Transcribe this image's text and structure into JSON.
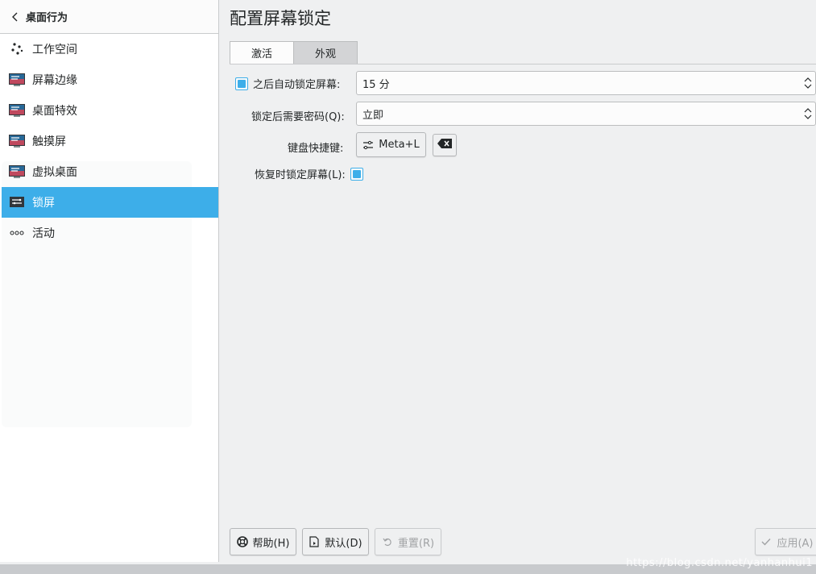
{
  "sidebar": {
    "title": "桌面行为",
    "items": [
      {
        "label": "工作空间",
        "icon": "workspace-icon",
        "active": false
      },
      {
        "label": "屏幕边缘",
        "icon": "screen-edges-icon",
        "active": false
      },
      {
        "label": "桌面特效",
        "icon": "desktop-effects-icon",
        "active": false
      },
      {
        "label": "触摸屏",
        "icon": "touchscreen-icon",
        "active": false
      },
      {
        "label": "虚拟桌面",
        "icon": "virtual-desktops-icon",
        "active": false
      },
      {
        "label": "锁屏",
        "icon": "screen-lock-icon",
        "active": true
      },
      {
        "label": "活动",
        "icon": "activities-icon",
        "active": false
      }
    ]
  },
  "main": {
    "title": "配置屏幕锁定",
    "tabs": [
      {
        "label": "激活",
        "active": true
      },
      {
        "label": "外观",
        "active": false
      }
    ],
    "form": {
      "auto_lock_label": "之后自动锁定屏幕:",
      "auto_lock_checked": true,
      "auto_lock_value": "15 分",
      "require_password_label": "锁定后需要密码(Q):",
      "require_password_value": "立即",
      "shortcut_label": "键盘快捷键:",
      "shortcut_value": "Meta+L",
      "lock_on_resume_label": "恢复时锁定屏幕(L):",
      "lock_on_resume_checked": true
    },
    "buttons": {
      "help": "帮助(H)",
      "defaults": "默认(D)",
      "reset": "重置(R)",
      "apply": "应用(A)"
    }
  },
  "watermark": "https://blog.csdn.net/yanhanhui1",
  "colors": {
    "accent": "#3daee9",
    "window_bg": "#eff0f1",
    "text": "#232627"
  }
}
